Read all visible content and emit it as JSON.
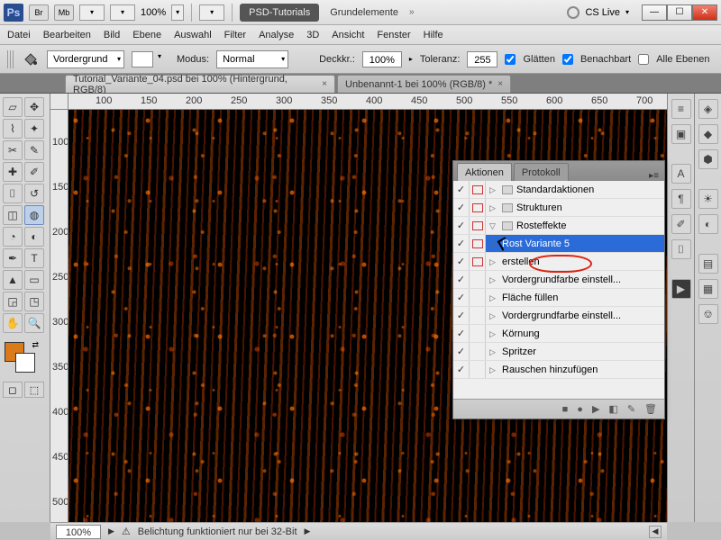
{
  "titlebar": {
    "app": "Ps",
    "br": "Br",
    "mb": "Mb",
    "zoom": "100%",
    "workspace_button": "PSD-Tutorials",
    "doc_title": "Grundelemente",
    "cs_live": "CS Live"
  },
  "menu": [
    "Datei",
    "Bearbeiten",
    "Bild",
    "Ebene",
    "Auswahl",
    "Filter",
    "Analyse",
    "3D",
    "Ansicht",
    "Fenster",
    "Hilfe"
  ],
  "options": {
    "fill_source": "Vordergrund",
    "mode_label": "Modus:",
    "mode_value": "Normal",
    "opacity_label": "Deckkr.:",
    "opacity_value": "100%",
    "tolerance_label": "Toleranz:",
    "tolerance_value": "255",
    "antialiased_label": "Glätten",
    "antialiased": true,
    "contiguous_label": "Benachbart",
    "contiguous": true,
    "all_layers_label": "Alle Ebenen",
    "all_layers": false
  },
  "tabs": [
    {
      "label": "Tutorial_Variante_04.psd bei 100% (Hintergrund, RGB/8)",
      "active": false
    },
    {
      "label": "Unbenannt-1 bei 100% (RGB/8) *",
      "active": true
    }
  ],
  "ruler_h": [
    "100",
    "150",
    "200",
    "250",
    "300",
    "350",
    "400",
    "450",
    "500",
    "550",
    "600",
    "650",
    "700"
  ],
  "ruler_v": [
    "100",
    "150",
    "200",
    "250",
    "300",
    "350",
    "400",
    "450",
    "500"
  ],
  "fg_color": "#d97a1b",
  "bg_color": "#ffffff",
  "panel": {
    "tab_active": "Aktionen",
    "tab_inactive": "Protokoll",
    "items": [
      {
        "kind": "set",
        "label": "Standardaktionen",
        "checked": true,
        "redbox": true,
        "indent": 0,
        "open": false
      },
      {
        "kind": "set",
        "label": "Strukturen",
        "checked": true,
        "redbox": true,
        "indent": 0,
        "open": false
      },
      {
        "kind": "set",
        "label": "Rosteffekte",
        "checked": true,
        "redbox": true,
        "indent": 0,
        "open": true
      },
      {
        "kind": "action",
        "label": "Rost Variante 5",
        "checked": true,
        "redbox": true,
        "indent": 1,
        "open": true,
        "selected": true
      },
      {
        "kind": "step",
        "label": "erstellen",
        "checked": true,
        "redbox": true,
        "indent": 2,
        "circled": true
      },
      {
        "kind": "step",
        "label": "Vordergrundfarbe einstell...",
        "checked": true,
        "redbox": false,
        "indent": 2
      },
      {
        "kind": "step",
        "label": "Fläche füllen",
        "checked": true,
        "redbox": false,
        "indent": 2
      },
      {
        "kind": "step",
        "label": "Vordergrundfarbe einstell...",
        "checked": true,
        "redbox": false,
        "indent": 2
      },
      {
        "kind": "step",
        "label": "Körnung",
        "checked": true,
        "redbox": false,
        "indent": 2
      },
      {
        "kind": "step",
        "label": "Spritzer",
        "checked": true,
        "redbox": false,
        "indent": 2
      },
      {
        "kind": "step",
        "label": "Rauschen hinzufügen",
        "checked": true,
        "redbox": false,
        "indent": 2
      }
    ],
    "footer_icons": [
      "■",
      "●",
      "▶",
      "◧",
      "✎",
      "🗑"
    ]
  },
  "status": {
    "zoom": "100%",
    "info": "Belichtung funktioniert nur bei 32-Bit"
  }
}
